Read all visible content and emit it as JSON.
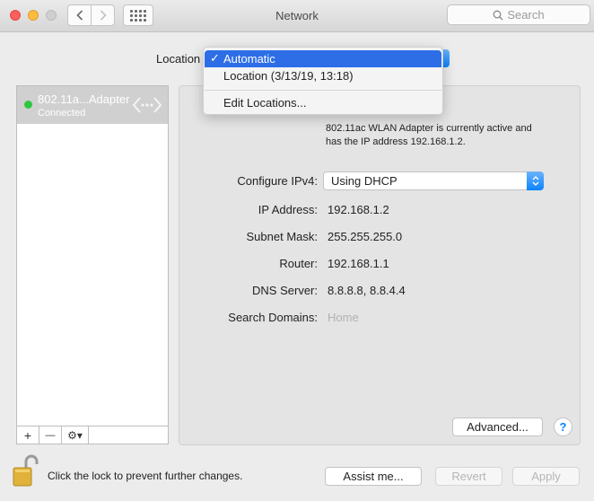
{
  "window": {
    "title": "Network"
  },
  "toolbar": {
    "search_placeholder": "Search"
  },
  "location": {
    "label": "Location",
    "menu": {
      "selected_check": "✓",
      "items": [
        "Automatic",
        "Location (3/13/19, 13:18)"
      ],
      "edit_label": "Edit Locations..."
    }
  },
  "sidebar": {
    "service": {
      "name": "802.11a...Adapter",
      "status": "Connected"
    },
    "add_label": "+",
    "remove_label": "—",
    "action_label": "⚙︎▾"
  },
  "details": {
    "status_text": "802.11ac WLAN Adapter  is currently active and has the IP address 192.168.1.2.",
    "configure_ipv4": {
      "label": "Configure IPv4:",
      "value": "Using DHCP"
    },
    "ip_address": {
      "label": "IP Address:",
      "value": "192.168.1.2"
    },
    "subnet_mask": {
      "label": "Subnet Mask:",
      "value": "255.255.255.0"
    },
    "router": {
      "label": "Router:",
      "value": "192.168.1.1"
    },
    "dns_server": {
      "label": "DNS Server:",
      "value": "8.8.8.8, 8.8.4.4"
    },
    "search_domains": {
      "label": "Search Domains:",
      "placeholder": "Home"
    },
    "advanced_label": "Advanced...",
    "help_label": "?"
  },
  "footer": {
    "lock_text": "Click the lock to prevent further changes.",
    "assist_label": "Assist me...",
    "revert_label": "Revert",
    "apply_label": "Apply"
  },
  "colors": {
    "accent": "#0a84ff",
    "selection": "#2d6ee6",
    "connected": "#2bc840",
    "close": "#fc605c",
    "minimize": "#fdbc40"
  },
  "icons": {
    "back": "chevron-left-icon",
    "forward": "chevron-right-icon",
    "show_all": "grid-icon",
    "search": "search-icon",
    "service": "ethernet-arrows-icon",
    "lock": "lock-open-icon",
    "gear": "gear-icon"
  }
}
